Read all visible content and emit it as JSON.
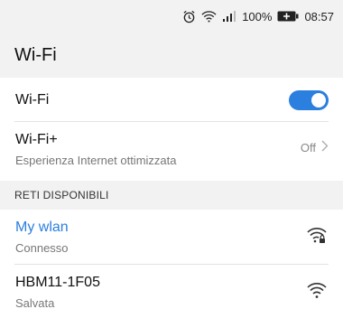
{
  "status": {
    "alarm_icon": "alarm-icon",
    "wifi_icon": "wifi-status-icon",
    "signal_icon": "signal-icon",
    "battery": "100%",
    "time": "08:57"
  },
  "header": {
    "title": "Wi-Fi"
  },
  "wifi_toggle": {
    "label": "Wi-Fi",
    "state": "on",
    "accent": "#2b7fde"
  },
  "wifi_plus": {
    "label": "Wi-Fi+",
    "description": "Esperienza Internet ottimizzata",
    "value": "Off"
  },
  "section": {
    "title": "RETI DISPONIBILI"
  },
  "networks": [
    {
      "name": "My wlan",
      "status": "Connesso",
      "name_color": "#2b7fde",
      "icon": "wifi-locked-icon"
    },
    {
      "name": "HBM11-1F05",
      "status": "Salvata",
      "name_color": "#111111",
      "icon": "wifi-signal-icon"
    }
  ]
}
